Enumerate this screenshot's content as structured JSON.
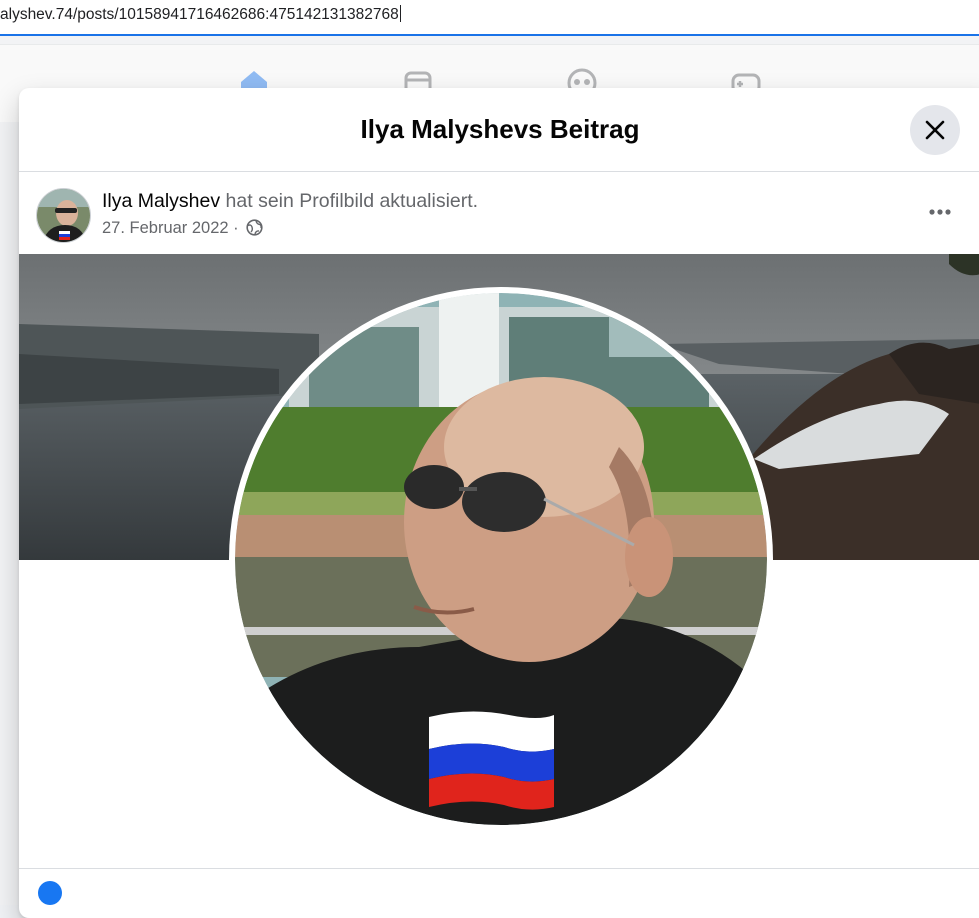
{
  "browser": {
    "address_url": "alyshev.74/posts/10158941716462686:475142131382768"
  },
  "modal": {
    "title": "Ilya Malyshevs Beitrag",
    "close_icon": "close-icon"
  },
  "post": {
    "author_name": "Ilya Malyshev",
    "action_text": " hat sein Profilbild aktualisiert.",
    "date": "27. Februar 2022",
    "separator": " · ",
    "audience_icon": "globe-icon",
    "more_icon": "more-options-icon"
  },
  "colors": {
    "accent": "#1877f2",
    "address_focus": "#1a73e8",
    "text_primary": "#050505",
    "text_secondary": "#65676b",
    "close_bg": "#e4e6eb"
  }
}
